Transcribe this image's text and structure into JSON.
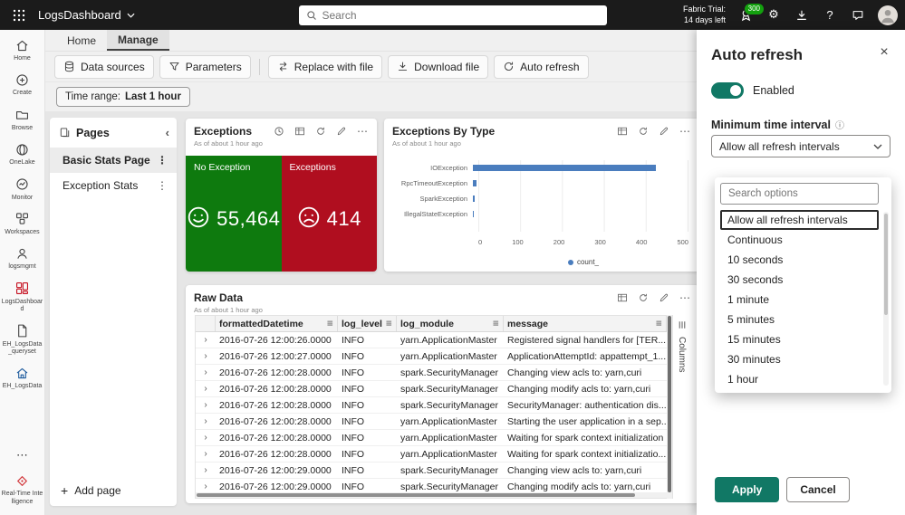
{
  "topbar": {
    "app_name": "LogsDashboard",
    "search_placeholder": "Search",
    "trial_line1": "Fabric Trial:",
    "trial_line2": "14 days left",
    "points_badge": "300"
  },
  "rail": {
    "items": [
      {
        "label": "Home"
      },
      {
        "label": "Create"
      },
      {
        "label": "Browse"
      },
      {
        "label": "OneLake"
      },
      {
        "label": "Monitor"
      },
      {
        "label": "Workspaces"
      },
      {
        "label": "logsmgmt"
      },
      {
        "label": "LogsDashboard",
        "selected": true
      },
      {
        "label": "EH_LogsData_queryset"
      },
      {
        "label": "EH_LogsData"
      },
      {
        "label": "Real-Time Intelligence"
      }
    ]
  },
  "tabs": {
    "items": [
      {
        "label": "Home"
      },
      {
        "label": "Manage",
        "selected": true
      }
    ]
  },
  "toolbar": {
    "buttons": [
      "Data sources",
      "Parameters",
      "Replace with file",
      "Download file",
      "Auto refresh"
    ]
  },
  "time_range": {
    "label": "Time range:",
    "value": "Last 1 hour"
  },
  "pages_panel": {
    "title": "Pages",
    "items": [
      {
        "label": "Basic Stats Page",
        "selected": true
      },
      {
        "label": "Exception Stats"
      }
    ],
    "add_page": "Add page"
  },
  "exceptions_tile": {
    "title": "Exceptions",
    "as_of": "As of about 1 hour ago",
    "cards": [
      {
        "label": "No Exception",
        "value": "55,464",
        "color": "#0e7a0e",
        "face": "happy"
      },
      {
        "label": "Exceptions",
        "value": "414",
        "color": "#b00e1f",
        "face": "sad"
      }
    ]
  },
  "by_type_tile": {
    "title": "Exceptions By Type",
    "as_of": "As of about 1 hour ago"
  },
  "chart_data": {
    "type": "bar",
    "orientation": "horizontal",
    "title": "Exceptions By Type",
    "categories": [
      "IOException",
      "RpcTimeoutException",
      "SparkException",
      "IllegalStateException"
    ],
    "values": [
      425,
      8,
      4,
      2
    ],
    "xticks": [
      "0",
      "100",
      "200",
      "300",
      "400",
      "500"
    ],
    "xlim": [
      0,
      500
    ],
    "legend": [
      "count_"
    ],
    "bar_color": "#4a7dbe",
    "grid": true,
    "legend_position": "bottom"
  },
  "raw_data_tile": {
    "title": "Raw Data",
    "as_of": "As of about 1 hour ago",
    "columns": [
      "formattedDatetime",
      "log_level",
      "log_module",
      "message"
    ],
    "columns_strip_label": "Columns",
    "rows": [
      [
        "2016-07-26 12:00:26.0000",
        "INFO",
        "yarn.ApplicationMaster",
        "Registered signal handlers for [TER..."
      ],
      [
        "2016-07-26 12:00:27.0000",
        "INFO",
        "yarn.ApplicationMaster",
        "ApplicationAttemptId: appattempt_1..."
      ],
      [
        "2016-07-26 12:00:28.0000",
        "INFO",
        "spark.SecurityManager",
        "Changing view acls to: yarn,curi"
      ],
      [
        "2016-07-26 12:00:28.0000",
        "INFO",
        "spark.SecurityManager",
        "Changing modify acls to: yarn,curi"
      ],
      [
        "2016-07-26 12:00:28.0000",
        "INFO",
        "spark.SecurityManager",
        "SecurityManager: authentication dis..."
      ],
      [
        "2016-07-26 12:00:28.0000",
        "INFO",
        "yarn.ApplicationMaster",
        "Starting the user application in a sep..."
      ],
      [
        "2016-07-26 12:00:28.0000",
        "INFO",
        "yarn.ApplicationMaster",
        "Waiting for spark context initialization"
      ],
      [
        "2016-07-26 12:00:28.0000",
        "INFO",
        "yarn.ApplicationMaster",
        "Waiting for spark context initializatio..."
      ],
      [
        "2016-07-26 12:00:29.0000",
        "INFO",
        "spark.SecurityManager",
        "Changing view acls to: yarn,curi"
      ],
      [
        "2016-07-26 12:00:29.0000",
        "INFO",
        "spark.SecurityManager",
        "Changing modify acls to: yarn,curi"
      ]
    ]
  },
  "panel": {
    "title": "Auto refresh",
    "enabled_label": "Enabled",
    "min_interval_label": "Minimum time interval",
    "dropdown_value": "Allow all refresh intervals",
    "search_placeholder": "Search options",
    "options": [
      {
        "label": "Allow all refresh intervals",
        "selected": true
      },
      {
        "label": "Continuous"
      },
      {
        "label": "10 seconds"
      },
      {
        "label": "30 seconds"
      },
      {
        "label": "1 minute"
      },
      {
        "label": "5 minutes"
      },
      {
        "label": "15 minutes"
      },
      {
        "label": "30 minutes"
      },
      {
        "label": "1 hour"
      }
    ],
    "apply_label": "Apply",
    "cancel_label": "Cancel",
    "accent_color": "#117865"
  }
}
